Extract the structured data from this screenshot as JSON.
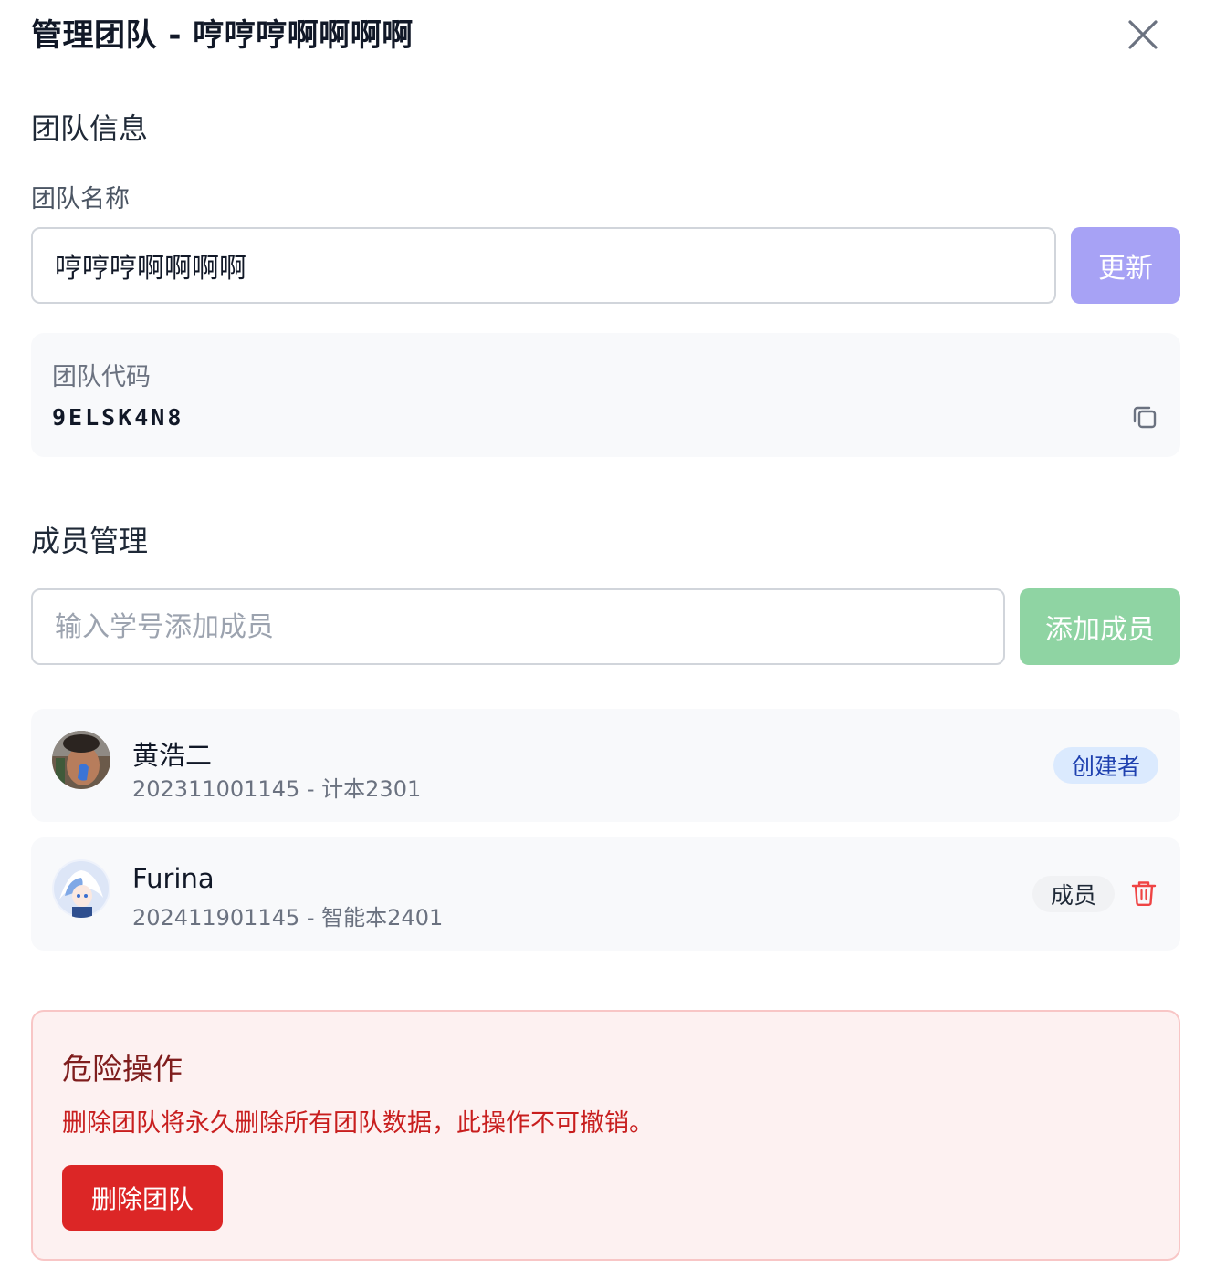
{
  "dialog": {
    "title": "管理团队 - 哼哼哼啊啊啊啊"
  },
  "team_info": {
    "section_title": "团队信息",
    "name_label": "团队名称",
    "name_value": "哼哼哼啊啊啊啊",
    "update_label": "更新",
    "code_label": "团队代码",
    "code_value": "9ELSK4N8"
  },
  "members": {
    "section_title": "成员管理",
    "add_placeholder": "输入学号添加成员",
    "add_label": "添加成员",
    "list": [
      {
        "name": "黄浩二",
        "info": "202311001145 - 计本2301",
        "role": "创建者"
      },
      {
        "name": "Furina",
        "info": "202411901145 - 智能本2401",
        "role": "成员"
      }
    ]
  },
  "danger_zone": {
    "title": "危险操作",
    "description": "删除团队将永久删除所有团队数据，此操作不可撤销。",
    "delete_label": "删除团队"
  },
  "colors": {
    "update_button": "#a7a2f5",
    "add_button": "#8fd4a3",
    "delete_button": "#dc2626",
    "creator_badge": "#dbeafe"
  },
  "icons": {
    "close": "close-icon",
    "copy": "copy-icon",
    "trash": "trash-icon"
  }
}
